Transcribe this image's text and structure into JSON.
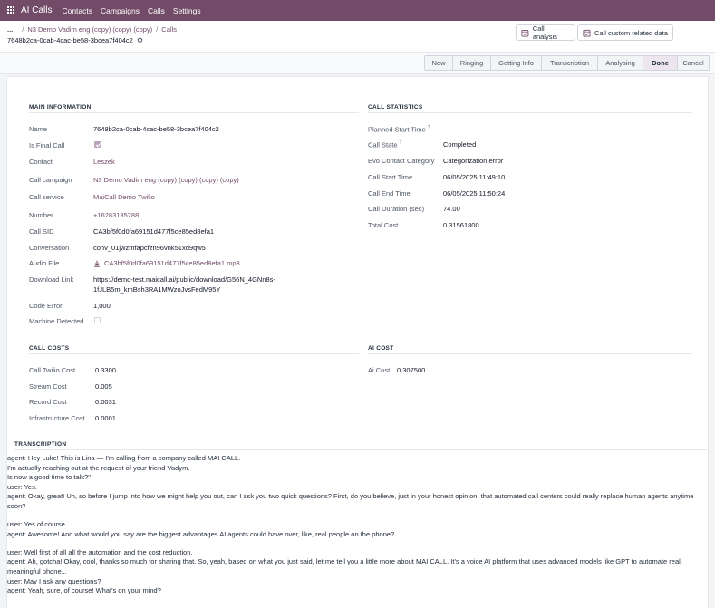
{
  "topbar": {
    "app_name": "AI Calls",
    "menu": [
      "Contacts",
      "Campaigns",
      "Calls",
      "Settings"
    ]
  },
  "breadcrumb": {
    "dots": "...",
    "items": [
      "N3 Demo Vadim eng (copy) (copy) (copy)",
      "Calls"
    ],
    "record_id": "7648b2ca-0cab-4cac-be58-3bcea7f404c2"
  },
  "actions": {
    "call_analysis": "Call analysis",
    "custom_data": "Call custom related data"
  },
  "statusbar": {
    "stages": [
      "New",
      "Ringing",
      "Getting Info",
      "Transcription",
      "Analysing",
      "Done"
    ],
    "current": "Done",
    "cancel": "Cancel"
  },
  "main_info": {
    "title": "MAIN INFORMATION",
    "name_label": "Name",
    "name": "7648b2ca-0cab-4cac-be58-3bcea7f404c2",
    "final_label": "Is Final Call",
    "contact_label": "Contact",
    "contact": "Leszek",
    "campaign_label": "Call campaign",
    "campaign": "N3 Demo Vadim eng (copy) (copy) (copy) (copy)",
    "service_label": "Call service",
    "service": "MaiCall Demo Twilio",
    "number_label": "Number",
    "number": "+16283135788",
    "sid_label": "Call SID",
    "sid": "CA3bf5f0d0fa69151d477f5ce85ed8efa1",
    "conversation_label": "Conversation",
    "conversation": "conv_01jwzmfapcfzn96vnk51xd9qw5",
    "audio_label": "Audio File",
    "audio": "CA3bf5f0d0fa69151d477f5ce85ed8efa1.mp3",
    "download_label": "Download Link",
    "download_1": "https://demo-test.maicall.ai/public/download/G56N_4GNn8s-",
    "download_2": "1fJLB5m_kmBsh3RA1MWzoJvsFedM95Y",
    "code_error_label": "Code Error",
    "code_error": "1,000",
    "machine_label": "Machine Detected"
  },
  "call_stats": {
    "title": "CALL STATISTICS",
    "planned_label": "Planned Start Time",
    "state_label": "Call State",
    "state": "Completed",
    "evo_label": "Evo Contact Category",
    "evo": "Categorization error",
    "start_label": "Call Start Time",
    "start": "06/05/2025 11:49:10",
    "end_label": "Call End Time",
    "end": "06/05/2025 11:50:24",
    "duration_label": "Call Duration (sec)",
    "duration": "74.00",
    "cost_label": "Total Cost",
    "cost": "0.31561800"
  },
  "call_costs": {
    "title": "CALL COSTS",
    "twilio_label": "Call Twilio Cost",
    "twilio": "0.3300",
    "stream_label": "Stream Cost",
    "stream": "0.005",
    "record_label": "Record Cost",
    "record": "0.0031",
    "infra_label": "Infrastructure Cost",
    "infra": "0.0001"
  },
  "ai_cost": {
    "title": "AI COST",
    "label": "Ai Cost",
    "value": "0.307500"
  },
  "transcription": {
    "title": "TRANSCRIPTION",
    "l1": "agent: Hey Luke! This is Lina — I'm calling from a company called MAI CALL.",
    "l2": "I'm actually reaching out at the request of your friend Vadym.",
    "l3": "Is now a good time to talk?\"",
    "l4": "user: Yes.",
    "l5": "agent: Okay, great! Uh, so before I jump into how we might help you out, can I ask you two quick questions? First, do you believe, just in your honest opinion, that automated call centers could really replace human agents anytime",
    "l6": "soon?",
    "l7": "user: Yes of course.",
    "l8": "agent: Awesome! And what would you say are the biggest advantages AI agents could have over, like, real people on the phone?",
    "l9": "user: Well first of all all the automation and the cost reduction.",
    "l10": "agent: Ah, gotcha! Okay, cool, thanks so much for sharing that. So, yeah, based on what you just said, let me tell you a little more about MAI CALL. It's a voice AI platform that uses advanced models like GPT to automate real,",
    "l11": "meaningful phone...",
    "l12": "user: May I ask any questions?",
    "l13": "agent: Yeah, sure, of course! What's on your mind?"
  }
}
